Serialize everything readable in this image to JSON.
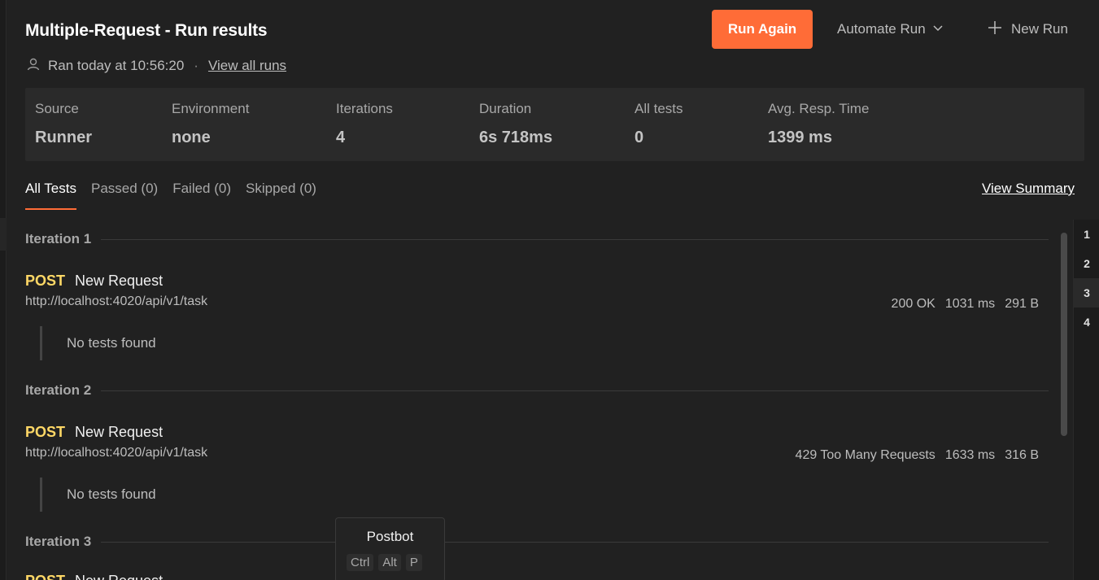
{
  "header": {
    "title": "Multiple-Request - Run results",
    "run_again_label": "Run Again",
    "automate_label": "Automate Run",
    "new_run_label": "New Run"
  },
  "meta": {
    "ran_text": "Ran today at 10:56:20",
    "separator": "·",
    "view_all_runs": "View all runs"
  },
  "stats": {
    "source_label": "Source",
    "source_value": "Runner",
    "environment_label": "Environment",
    "environment_value": "none",
    "iterations_label": "Iterations",
    "iterations_value": "4",
    "duration_label": "Duration",
    "duration_value": "6s 718ms",
    "all_tests_label": "All tests",
    "all_tests_value": "0",
    "avg_label": "Avg. Resp. Time",
    "avg_value": "1399 ms"
  },
  "tabs": {
    "all": "All Tests",
    "passed": "Passed (0)",
    "failed": "Failed (0)",
    "skipped": "Skipped (0)",
    "view_summary": "View Summary"
  },
  "iterations": [
    {
      "title": "Iteration 1",
      "method": "POST",
      "name": "New Request",
      "url": "http://localhost:4020/api/v1/task",
      "status": "200 OK",
      "time": "1031 ms",
      "size": "291 B",
      "tests": "No tests found"
    },
    {
      "title": "Iteration 2",
      "method": "POST",
      "name": "New Request",
      "url": "http://localhost:4020/api/v1/task",
      "status": "429 Too Many Requests",
      "time": "1633 ms",
      "size": "316 B",
      "tests": "No tests found"
    },
    {
      "title": "Iteration 3",
      "method": "POST",
      "name": "New Request"
    }
  ],
  "iteration_nav": [
    "1",
    "2",
    "3",
    "4"
  ],
  "postbot": {
    "title": "Postbot",
    "keys": [
      "Ctrl",
      "Alt",
      "P"
    ]
  },
  "colors": {
    "accent": "#ff6c37",
    "method_post": "#ffd866",
    "background": "#212121"
  },
  "icons": {
    "user": "user-icon",
    "chevron": "chevron-down-icon",
    "plus": "plus-icon"
  }
}
